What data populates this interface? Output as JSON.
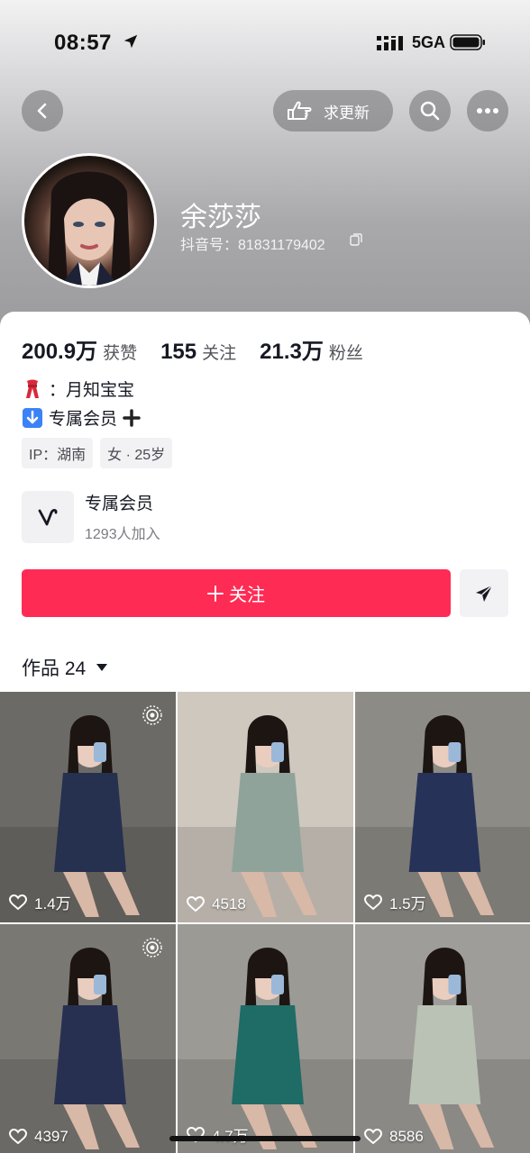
{
  "status_bar": {
    "time": "08:57",
    "network": "5GA"
  },
  "header": {
    "update_label": "求更新",
    "username": "余莎莎",
    "douyin_id": "抖音号：81831179402"
  },
  "stats": [
    {
      "num": "200.9万",
      "label": "获赞"
    },
    {
      "num": "155",
      "label": "关注"
    },
    {
      "num": "21.3万",
      "label": "粉丝"
    }
  ],
  "bio": {
    "line1": "：月知宝宝",
    "line2": "专属会员"
  },
  "tags": [
    "IP：湖南",
    "女 · 25岁"
  ],
  "member": {
    "title": "专属会员",
    "subtitle": "1293人加入"
  },
  "follow_label": "关注",
  "works_label": "作品 24",
  "grid": [
    {
      "likes": "1.4万",
      "live": true,
      "bg": "#6b6a66",
      "fig": "#26304f"
    },
    {
      "likes": "4518",
      "live": false,
      "bg": "#cfc8bf",
      "fig": "#8fa39b"
    },
    {
      "likes": "1.5万",
      "live": false,
      "bg": "#8d8b86",
      "fig": "#263258"
    },
    {
      "likes": "4397",
      "live": true,
      "bg": "#7a7873",
      "fig": "#283052"
    },
    {
      "likes": "4.7万",
      "live": false,
      "bg": "#9b9a95",
      "fig": "#1f6b66"
    },
    {
      "likes": "8586",
      "live": false,
      "bg": "#9e9d99",
      "fig": "#b9c2b4"
    }
  ]
}
